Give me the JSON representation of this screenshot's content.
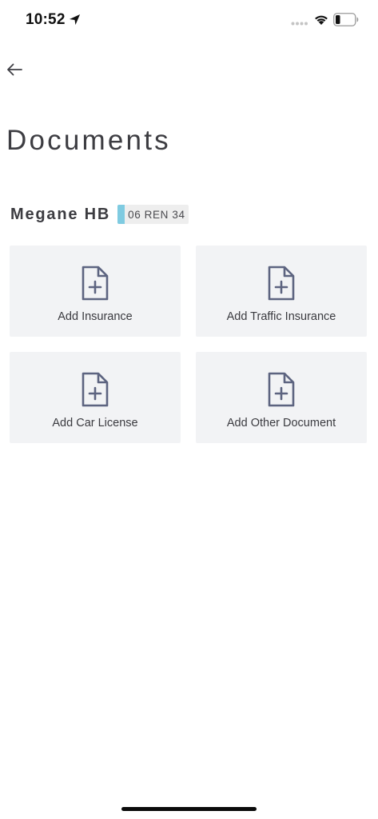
{
  "status_bar": {
    "time": "10:52"
  },
  "header": {
    "title": "Documents"
  },
  "vehicle": {
    "name": "Megane HB",
    "plate": "06 REN 34",
    "plate_color": "#7fcbe1"
  },
  "documents": {
    "add_insurance": "Add Insurance",
    "add_traffic_insurance": "Add Traffic Insurance",
    "add_car_license": "Add Car License",
    "add_other_document": "Add Other Document",
    "icon": "file-plus-icon",
    "icon_color": "#5d6480"
  }
}
